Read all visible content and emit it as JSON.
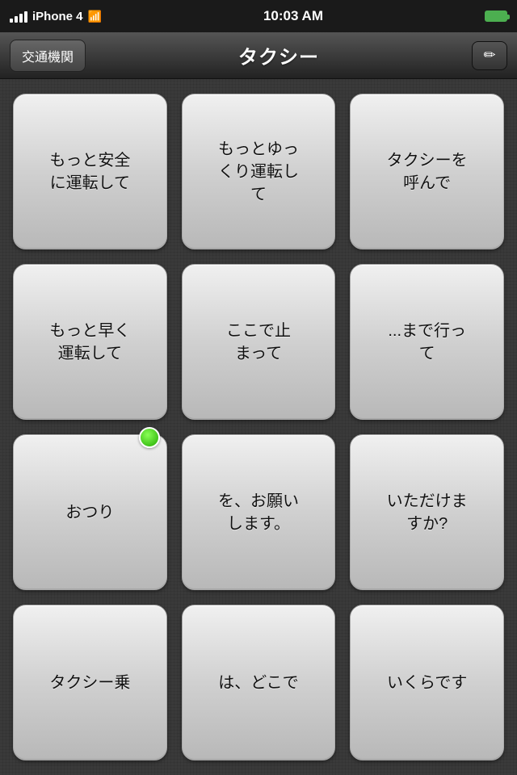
{
  "status_bar": {
    "device": "iPhone 4",
    "time": "10:03 AM",
    "signal_bars": 4
  },
  "nav": {
    "back_label": "交通機関",
    "title": "タクシー",
    "edit_icon": "✎"
  },
  "grid": {
    "rows": [
      [
        {
          "id": "btn-1",
          "text": "もっと安全\nに運転して"
        },
        {
          "id": "btn-2",
          "text": "もっとゆっ\nくり運転し\nて"
        },
        {
          "id": "btn-3",
          "text": "タクシーを\n呼んで"
        }
      ],
      [
        {
          "id": "btn-4",
          "text": "もっと早く\n運転して"
        },
        {
          "id": "btn-5",
          "text": "ここで止\nまって"
        },
        {
          "id": "btn-6",
          "text": "...まで行っ\nて"
        }
      ],
      [
        {
          "id": "btn-7",
          "text": "おつり",
          "has_dot": true
        },
        {
          "id": "btn-8",
          "text": "を、お願い\nします。"
        },
        {
          "id": "btn-9",
          "text": "いただけま\nすか?"
        }
      ],
      [
        {
          "id": "btn-10",
          "text": "タクシー乗\n..."
        },
        {
          "id": "btn-11",
          "text": "は、どこで\n..."
        },
        {
          "id": "btn-12",
          "text": "いくらです\n..."
        }
      ]
    ]
  }
}
